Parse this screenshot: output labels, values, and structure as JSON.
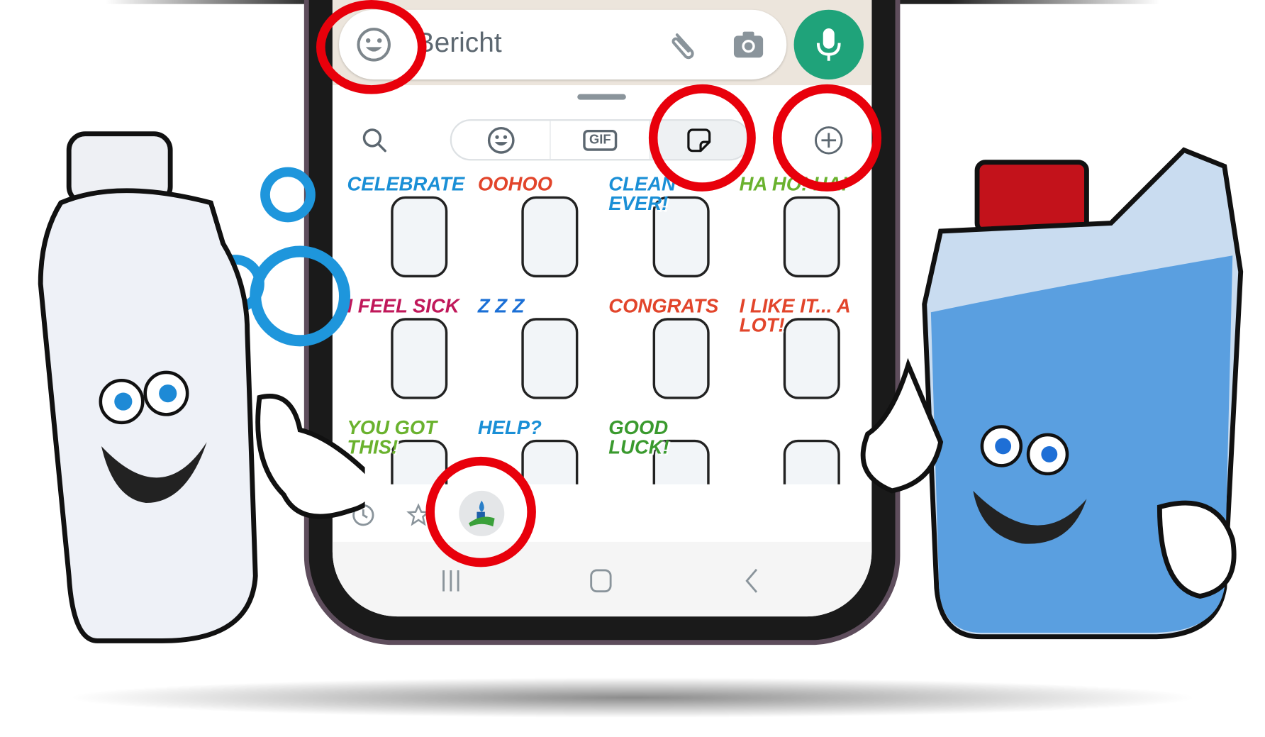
{
  "composer": {
    "placeholder": "Bericht",
    "icons": [
      "emoji-icon",
      "paperclip-icon",
      "camera-icon",
      "microphone-icon"
    ]
  },
  "picker_tabs": [
    {
      "name": "search"
    },
    {
      "name": "emoji"
    },
    {
      "name": "gif",
      "label": "GIF"
    },
    {
      "name": "stickers",
      "selected": true
    },
    {
      "name": "add"
    }
  ],
  "stickers": [
    {
      "text": "CELEBRATE",
      "color": "#1a8fd6"
    },
    {
      "text": "OOHOO",
      "color": "#e2452b"
    },
    {
      "text": "CLEAN EVER!",
      "color": "#1a8fd6"
    },
    {
      "text": "HA HO! HA!",
      "color": "#6ab22e"
    },
    {
      "text": "I FEEL SICK",
      "color": "#c0185a"
    },
    {
      "text": "Z Z Z",
      "color": "#1a6fd6"
    },
    {
      "text": "CONGRATS",
      "color": "#e2452b"
    },
    {
      "text": "I LIKE IT... A LOT!",
      "color": "#e2452b"
    },
    {
      "text": "YOU GOT THIS!",
      "color": "#6ab22e"
    },
    {
      "text": "HELP?",
      "color": "#1a8fd6"
    },
    {
      "text": "GOOD LUCK!",
      "color": "#3a9a2e"
    },
    {
      "text": "",
      "color": "#f08a2e"
    }
  ],
  "tray": [
    "recent-icon",
    "favorites-star-icon",
    "sticker-pack-icon"
  ],
  "nav": [
    "recent-apps-icon",
    "home-icon",
    "back-icon"
  ],
  "colors": {
    "accent": "#1fa37a",
    "highlight": "#e8000b"
  }
}
